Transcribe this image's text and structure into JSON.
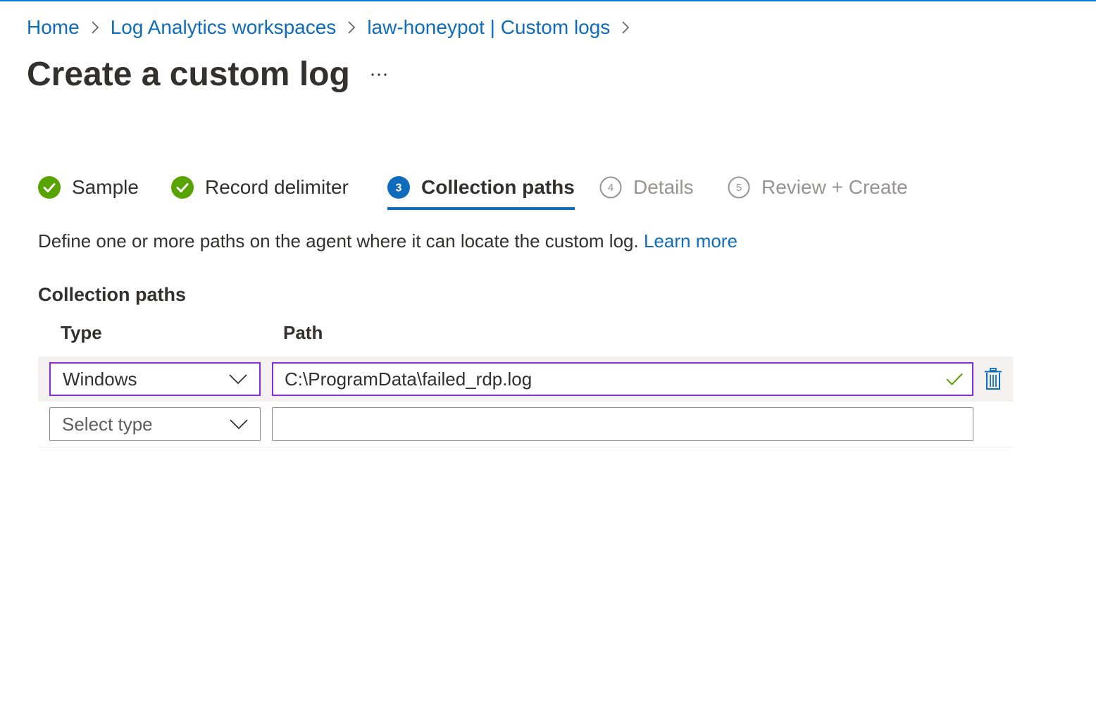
{
  "colors": {
    "accent": "#0f6cbd",
    "success": "#57a300",
    "focus_border": "#8a2be2",
    "text": "#323130",
    "muted": "#979593"
  },
  "breadcrumb": {
    "items": [
      {
        "label": "Home"
      },
      {
        "label": "Log Analytics workspaces"
      },
      {
        "label": "law-honeypot | Custom logs"
      }
    ],
    "separator_icon": "chevron-right-icon"
  },
  "page": {
    "title": "Create a custom log",
    "more_icon": "more-icon"
  },
  "wizard": {
    "steps": [
      {
        "label": "Sample",
        "state": "completed",
        "icon": "check-circle-icon"
      },
      {
        "label": "Record delimiter",
        "state": "completed",
        "icon": "check-circle-icon"
      },
      {
        "label": "Collection paths",
        "state": "active",
        "number": "3"
      },
      {
        "label": "Details",
        "state": "upcoming",
        "number": "4"
      },
      {
        "label": "Review + Create",
        "state": "upcoming",
        "number": "5"
      }
    ]
  },
  "description": {
    "text": "Define one or more paths on the agent where it can locate the custom log.",
    "link": "Learn more"
  },
  "collection": {
    "section_title": "Collection paths",
    "columns": {
      "type": "Type",
      "path": "Path"
    },
    "rows": [
      {
        "type": "Windows",
        "path": "C:\\ProgramData\\failed_rdp.log",
        "valid": true,
        "delete_icon": "trash-icon"
      },
      {
        "type_placeholder": "Select type",
        "path": ""
      }
    ]
  }
}
